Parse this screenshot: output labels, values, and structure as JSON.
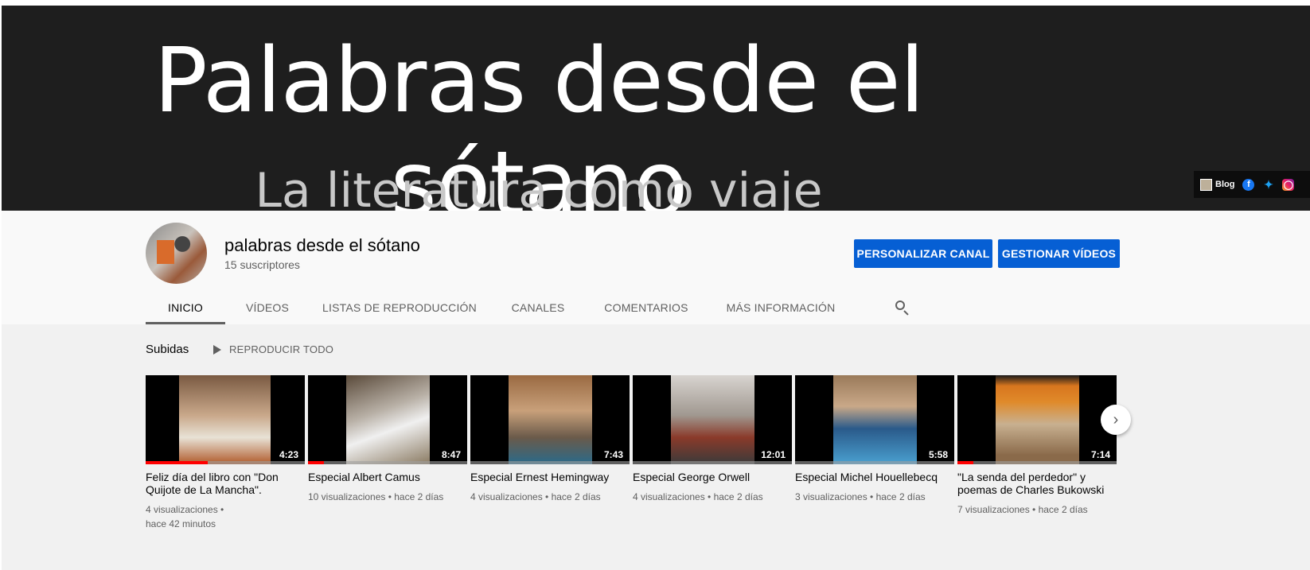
{
  "banner": {
    "title": "Palabras desde el sótano",
    "subtitle": "La literatura como viaje",
    "links": [
      {
        "label": "Blog",
        "icon": "blog-icon"
      },
      {
        "label": "",
        "icon": "facebook-icon"
      },
      {
        "label": "",
        "icon": "twitter-icon"
      },
      {
        "label": "",
        "icon": "instagram-icon"
      }
    ]
  },
  "channel": {
    "name": "palabras desde el sótano",
    "subscribers": "15 suscriptores",
    "customize_label": "PERSONALIZAR CANAL",
    "manage_label": "GESTIONAR VÍDEOS"
  },
  "tabs": [
    {
      "label": "INICIO",
      "active": true
    },
    {
      "label": "VÍDEOS"
    },
    {
      "label": "LISTAS DE REPRODUCCIÓN"
    },
    {
      "label": "CANALES"
    },
    {
      "label": "COMENTARIOS"
    },
    {
      "label": "MÁS INFORMACIÓN"
    }
  ],
  "shelf": {
    "title": "Subidas",
    "play_all": "REPRODUCIR TODO"
  },
  "videos": [
    {
      "title": "Feliz día del libro con \"Don Quijote de La Mancha\".",
      "views": "4 visualizaciones •",
      "age": "hace 42 minutos",
      "duration": "4:23",
      "progress": 0.39,
      "color": "#8c6a4a"
    },
    {
      "title": "Especial Albert Camus",
      "views": "10 visualizaciones • hace 2 días",
      "age": "",
      "duration": "8:47",
      "progress": 0.1,
      "color": "#a9a9a9"
    },
    {
      "title": "Especial Ernest Hemingway",
      "views": "4 visualizaciones • hace 2 días",
      "age": "",
      "duration": "7:43",
      "progress": 0,
      "color": "#8a5a3a"
    },
    {
      "title": "Especial George Orwell",
      "views": "4 visualizaciones • hace 2 días",
      "age": "",
      "duration": "12:01",
      "progress": 0,
      "color": "#9a9490"
    },
    {
      "title": "Especial Michel Houellebecq",
      "views": "3 visualizaciones • hace 2 días",
      "age": "",
      "duration": "5:58",
      "progress": 0,
      "color": "#4a7aa0"
    },
    {
      "title": "\"La senda del perdedor\" y poemas de Charles Bukowski",
      "views": "7 visualizaciones • hace 2 días",
      "age": "",
      "duration": "7:14",
      "progress": 0.1,
      "color": "#d07a20"
    }
  ]
}
